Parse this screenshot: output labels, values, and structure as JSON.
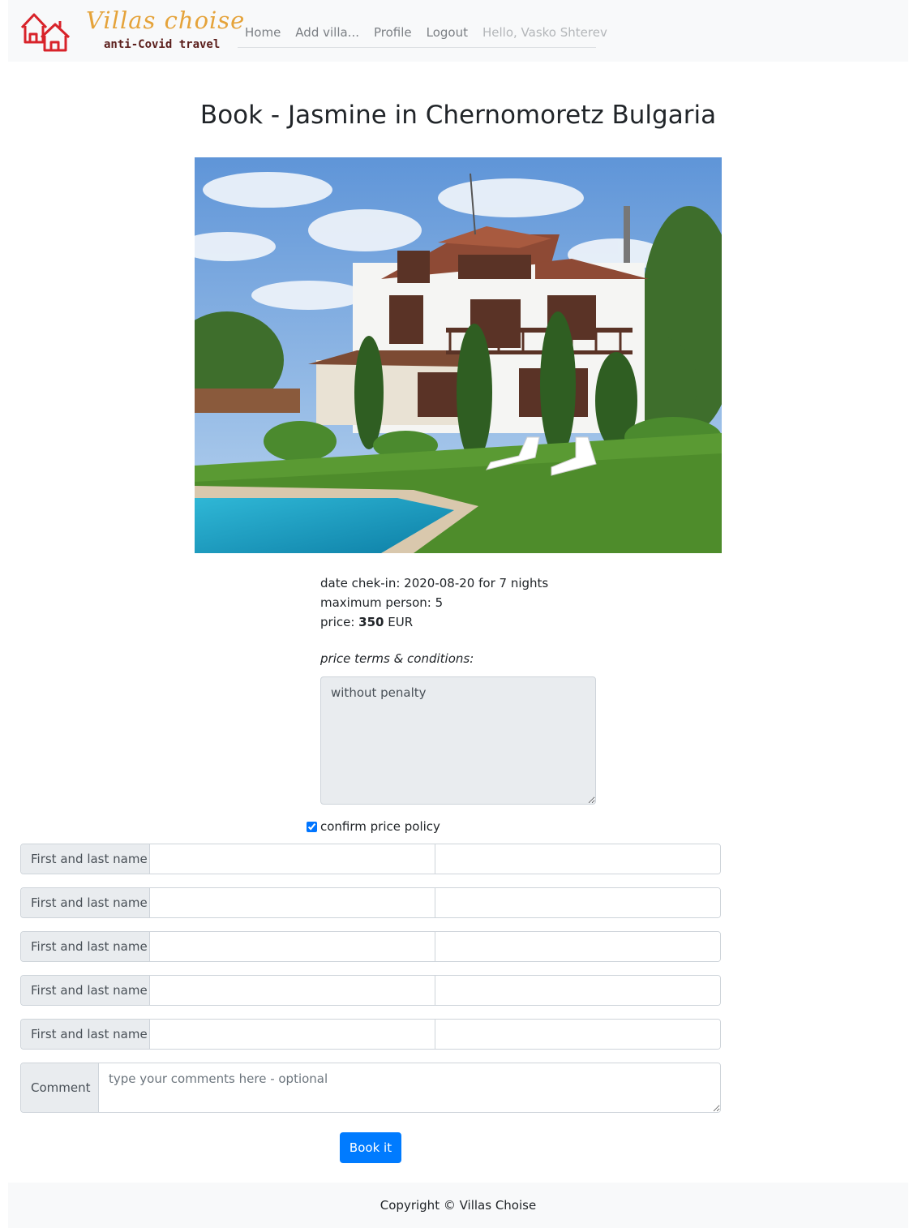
{
  "brand": {
    "title": "Villas choise",
    "subtitle": "anti-Covid travel"
  },
  "nav": {
    "items": [
      "Home",
      "Add villa...",
      "Profile",
      "Logout"
    ],
    "greeting": "Hello, Vasko Shterev"
  },
  "page": {
    "title": "Book - Jasmine in Chernomoretz Bulgaria"
  },
  "details": {
    "checkin": "date chek-in: 2020-08-20 for 7 nights",
    "max_person": "maximum person: 5",
    "price_label": "price:",
    "price_value": "350",
    "price_currency": "EUR"
  },
  "terms": {
    "label": "price terms & conditions:",
    "text": "without penalty"
  },
  "confirm": {
    "label": "confirm price policy",
    "checked": true
  },
  "guests": {
    "label": "First and last name",
    "count": 5
  },
  "comment": {
    "label": "Comment",
    "placeholder": "type your comments here - optional"
  },
  "book_button": "Book it",
  "footer": "Copyright © Villas Choise",
  "colors": {
    "primary": "#007bff",
    "logo_red": "#d8232a",
    "logo_gold": "#e5a33a",
    "navbar_bg": "#f8f9fa"
  }
}
